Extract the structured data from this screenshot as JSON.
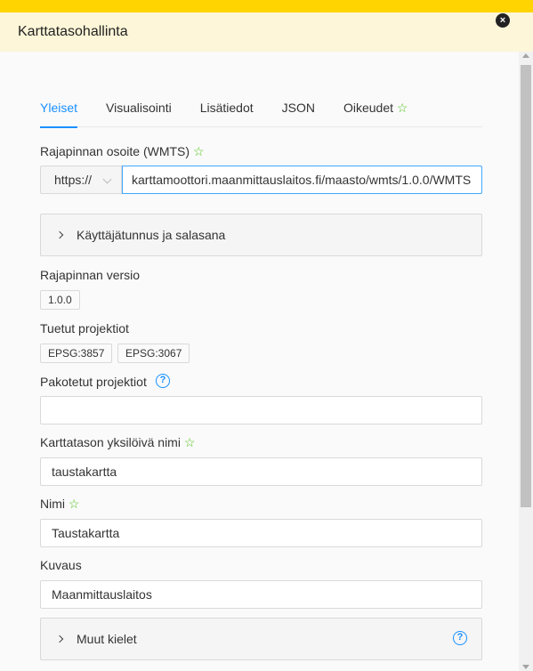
{
  "header": {
    "title": "Karttatasohallinta",
    "close_label": "×"
  },
  "tabs": [
    {
      "label": "Yleiset"
    },
    {
      "label": "Visualisointi"
    },
    {
      "label": "Lisätiedot"
    },
    {
      "label": "JSON"
    },
    {
      "label": "Oikeudet"
    }
  ],
  "api_url": {
    "label": "Rajapinnan osoite (WMTS)",
    "protocol": "https://",
    "value": "karttamoottori.maanmittauslaitos.fi/maasto/wmts/1.0.0/WMTS"
  },
  "credentials": {
    "label": "Käyttäjätunnus ja salasana"
  },
  "api_version": {
    "label": "Rajapinnan versio",
    "value": "1.0.0"
  },
  "supported_projections": {
    "label": "Tuetut projektiot",
    "values": [
      "EPSG:3857",
      "EPSG:3067"
    ]
  },
  "forced_projections": {
    "label": "Pakotetut projektiot",
    "value": ""
  },
  "unique_name": {
    "label": "Karttatason yksilöivä nimi",
    "value": "taustakartta"
  },
  "name": {
    "label": "Nimi",
    "value": "Taustakartta"
  },
  "description": {
    "label": "Kuvaus",
    "value": "Maanmittauslaitos"
  },
  "other_languages": {
    "label": "Muut kielet"
  },
  "icons": {
    "star": "☆",
    "help": "?"
  },
  "colors": {
    "accent": "#1890ff",
    "topbar": "#ffd400",
    "header_bg": "#fdf6d8",
    "star": "#52c41a"
  }
}
